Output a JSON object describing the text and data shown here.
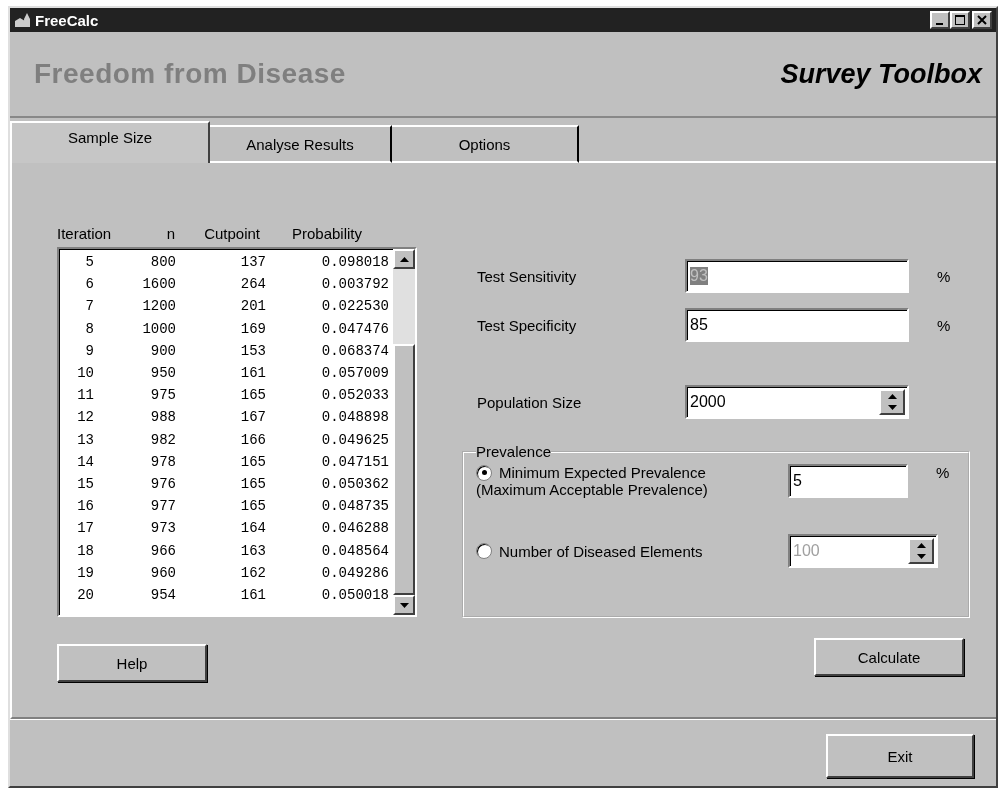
{
  "window": {
    "title": "FreeCalc"
  },
  "header": {
    "title": "Freedom from Disease",
    "brand": "Survey Toolbox"
  },
  "tabs": [
    {
      "label": "Sample Size",
      "selected": true
    },
    {
      "label": "Analyse Results",
      "selected": false
    },
    {
      "label": "Options",
      "selected": false
    }
  ],
  "table": {
    "columns": [
      "Iteration",
      "n",
      "Cutpoint",
      "Probability"
    ],
    "rows": [
      [
        "5",
        "800",
        "137",
        "0.098018"
      ],
      [
        "6",
        "1600",
        "264",
        "0.003792"
      ],
      [
        "7",
        "1200",
        "201",
        "0.022530"
      ],
      [
        "8",
        "1000",
        "169",
        "0.047476"
      ],
      [
        "9",
        "900",
        "153",
        "0.068374"
      ],
      [
        "10",
        "950",
        "161",
        "0.057009"
      ],
      [
        "11",
        "975",
        "165",
        "0.052033"
      ],
      [
        "12",
        "988",
        "167",
        "0.048898"
      ],
      [
        "13",
        "982",
        "166",
        "0.049625"
      ],
      [
        "14",
        "978",
        "165",
        "0.047151"
      ],
      [
        "15",
        "976",
        "165",
        "0.050362"
      ],
      [
        "16",
        "977",
        "165",
        "0.048735"
      ],
      [
        "17",
        "973",
        "164",
        "0.046288"
      ],
      [
        "18",
        "966",
        "163",
        "0.048564"
      ],
      [
        "19",
        "960",
        "162",
        "0.049286"
      ],
      [
        "20",
        "954",
        "161",
        "0.050018"
      ]
    ]
  },
  "fields": [
    {
      "label": "Test Sensitivity",
      "value": "93",
      "selected": true,
      "kind": "percent"
    },
    {
      "label": "Test Specificity",
      "value": "85",
      "selected": false,
      "kind": "percent"
    },
    {
      "label": "Population Size",
      "value": "2000",
      "selected": false,
      "kind": "spinner"
    }
  ],
  "prevalence": {
    "title": "Prevalence",
    "options": [
      {
        "label": "Minimum Expected Prevalence",
        "sublabel": "(Maximum Acceptable Prevalence)",
        "selected": true,
        "value": "5",
        "disabled": false,
        "kind": "percent",
        "unit": "%"
      },
      {
        "label": "Number of Diseased Elements",
        "selected": false,
        "value": "100",
        "disabled": true,
        "kind": "spinner"
      }
    ]
  },
  "percent_unit": "%",
  "buttons": {
    "help": "Help",
    "calculate": "Calculate",
    "exit": "Exit"
  }
}
